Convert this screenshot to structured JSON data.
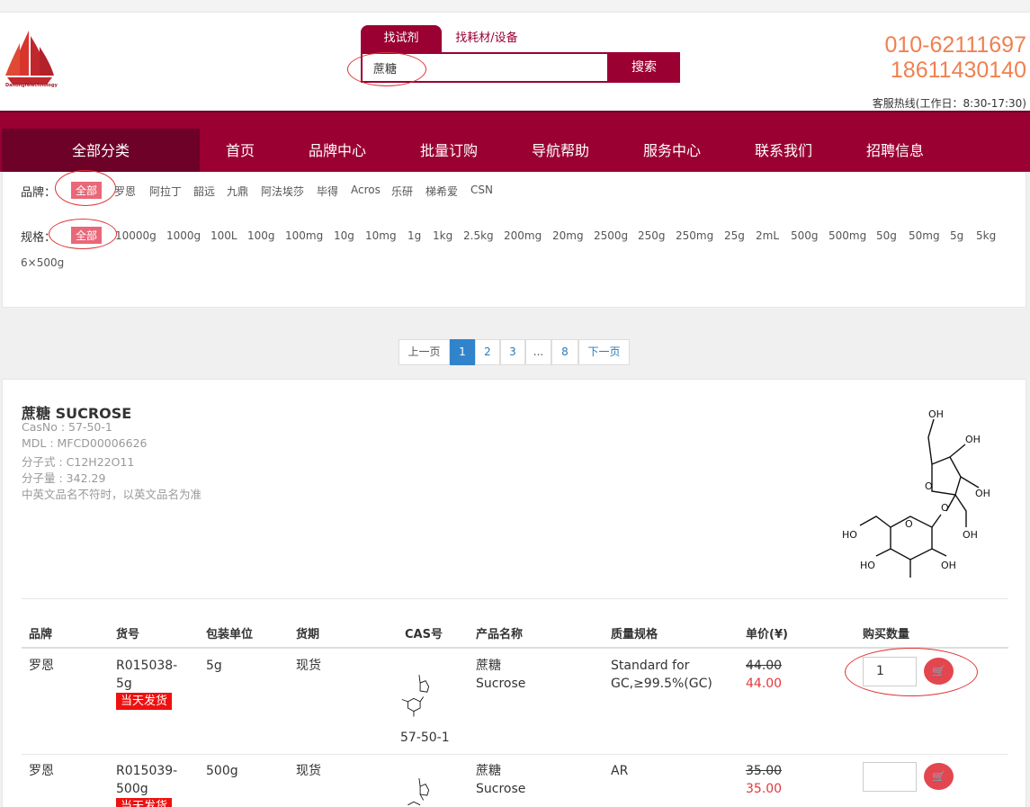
{
  "brand": {
    "logo_text": "Dahongfeiechnology"
  },
  "search": {
    "tabs": [
      "找试剂",
      "找耗材/设备"
    ],
    "value": "蔗糖",
    "button": "搜索"
  },
  "contact": {
    "phone1": "010-62111697",
    "phone2": "18611430140",
    "hotline": "客服热线(工作日：8:30-17:30)"
  },
  "nav": {
    "all": "全部分类",
    "items": [
      "首页",
      "品牌中心",
      "批量订购",
      "导航帮助",
      "服务中心",
      "联系我们",
      "招聘信息"
    ]
  },
  "filters": {
    "brand_label": "品牌：",
    "brand_options": [
      "全部",
      "罗恩",
      "阿拉丁",
      "韶远",
      "九鼎",
      "阿法埃莎",
      "毕得",
      "Acros",
      "乐研",
      "梯希爱",
      "CSN"
    ],
    "spec_label": "规格：",
    "spec_options": [
      "全部",
      "10000g",
      "1000g",
      "100L",
      "100g",
      "100mg",
      "10g",
      "10mg",
      "1g",
      "1kg",
      "2.5kg",
      "200mg",
      "20mg",
      "2500g",
      "250g",
      "250mg",
      "25g",
      "2mL",
      "500g",
      "500mg",
      "50g",
      "50mg",
      "5g",
      "5kg",
      "6×500g"
    ]
  },
  "pagination": {
    "prev": "上一页",
    "pages": [
      "1",
      "2",
      "3",
      "...",
      "8"
    ],
    "next": "下一页",
    "current": "1"
  },
  "product": {
    "title": "蔗糖 SUCROSE",
    "cas": "CasNo : 57-50-1",
    "mdl": "MDL : MFCD00006626",
    "formula": "分子式 : C12H22O11",
    "weight": "分子量 : 342.29",
    "note": "中英文品名不符时，以英文品名为准"
  },
  "table": {
    "headers": [
      "品牌",
      "货号",
      "包装单位",
      "货期",
      "CAS号",
      "产品名称",
      "质量规格",
      "单价(¥)",
      "购买数量"
    ],
    "rows": [
      {
        "brand": "罗恩",
        "sku": "R015038-5g",
        "badge": "当天发货",
        "pack": "5g",
        "lead": "现货",
        "cas": "57-50-1",
        "name_cn": "蔗糖",
        "name_en": "Sucrose",
        "grade": "Standard for GC,≥99.5%(GC)",
        "price_old": "44.00",
        "price_new": "44.00",
        "qty": "1"
      },
      {
        "brand": "罗恩",
        "sku": "R015039-500g",
        "badge": "当天发货",
        "pack": "500g",
        "lead": "现货",
        "cas": "",
        "name_cn": "蔗糖",
        "name_en": "Sucrose",
        "grade": "AR",
        "price_old": "35.00",
        "price_new": "35.00",
        "qty": ""
      }
    ]
  },
  "colors": {
    "primary": "#9b0033",
    "nav_dark": "#6d0128",
    "phone": "#f08050",
    "badge": "#ee1111",
    "price": "#e0393e",
    "page_active": "#3184cc"
  }
}
